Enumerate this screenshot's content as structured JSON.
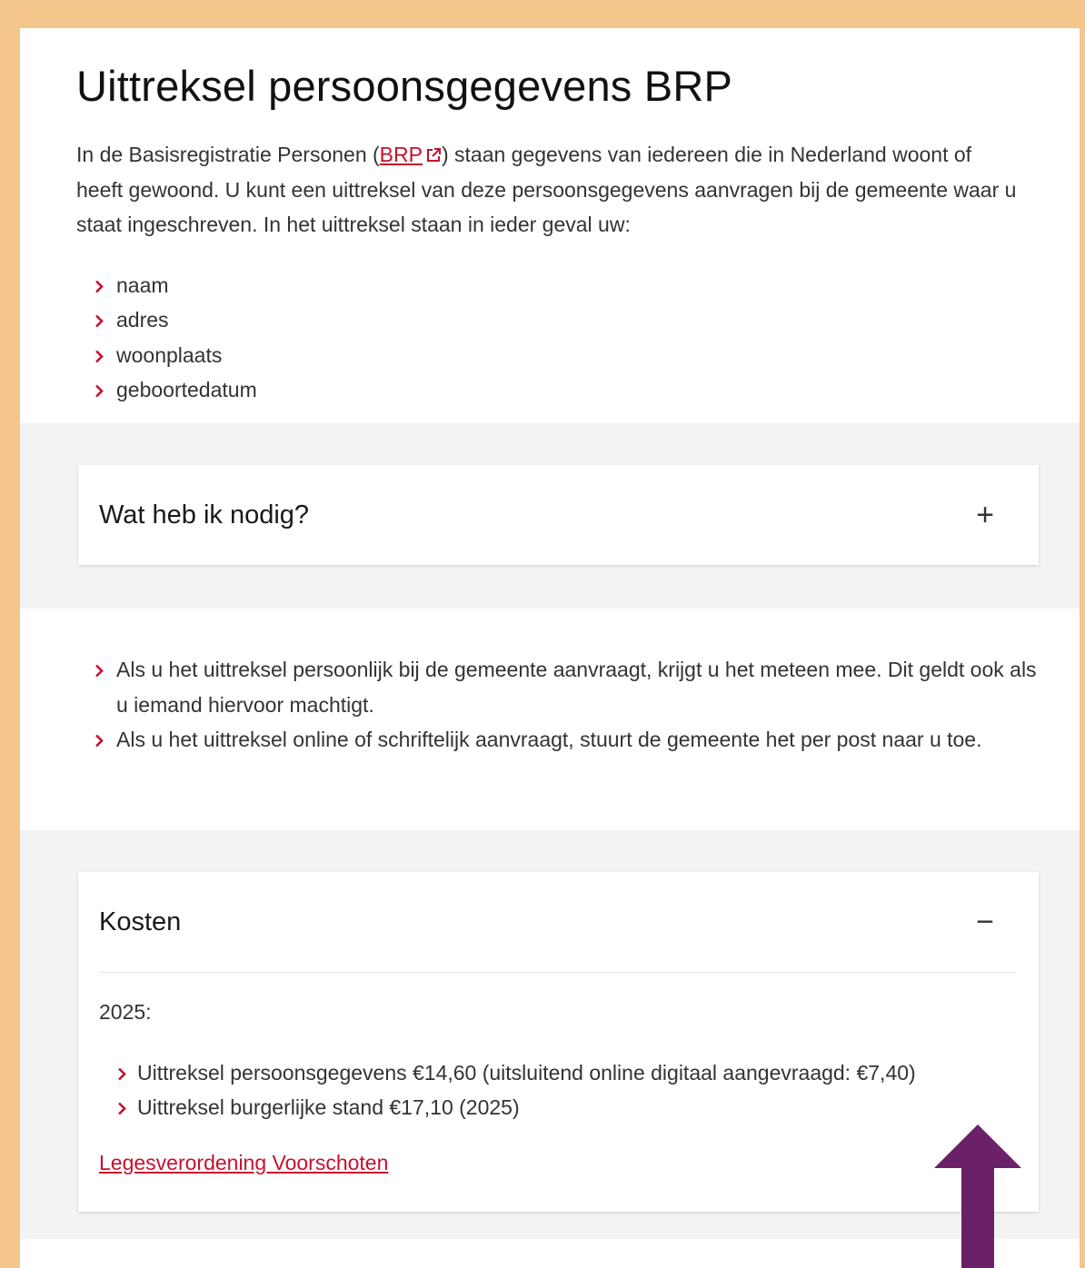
{
  "title": "Uittreksel persoonsgegevens BRP",
  "intro": {
    "before_link": "In de Basisregistratie Personen (",
    "link_label": "BRP",
    "after_link": ") staan gegevens van iedereen die in Nederland woont of heeft gewoond. U kunt een uittreksel van deze persoonsgegevens aanvragen bij de gemeente waar u staat ingeschreven. In het uittreksel staan in ieder geval uw:"
  },
  "intro_list": [
    "naam",
    "adres",
    "woonplaats",
    "geboortedatum"
  ],
  "accordion_needed": {
    "title": "Wat heb ik nodig?",
    "toggle": "+"
  },
  "delivery_list": [
    "Als u het uittreksel persoonlijk bij de gemeente aanvraagt, krijgt u het meteen mee. Dit geldt ook als u iemand hiervoor machtigt.",
    "Als u het uittreksel online of schriftelijk aanvraagt, stuurt de gemeente het per post naar u toe."
  ],
  "accordion_costs": {
    "title": "Kosten",
    "toggle": "−",
    "year": "2025:",
    "items": [
      "Uittreksel persoonsgegevens €14,60 (uitsluitend online digitaal aangevraagd: €7,40)",
      "Uittreksel burgerlijke stand €17,10 (2025)"
    ],
    "link_label": "Legesverordening Voorschoten"
  },
  "colors": {
    "frame": "#f5c68b",
    "accent": "#c8102e",
    "band": "#f3f3f3",
    "arrow": "#6b2168"
  }
}
